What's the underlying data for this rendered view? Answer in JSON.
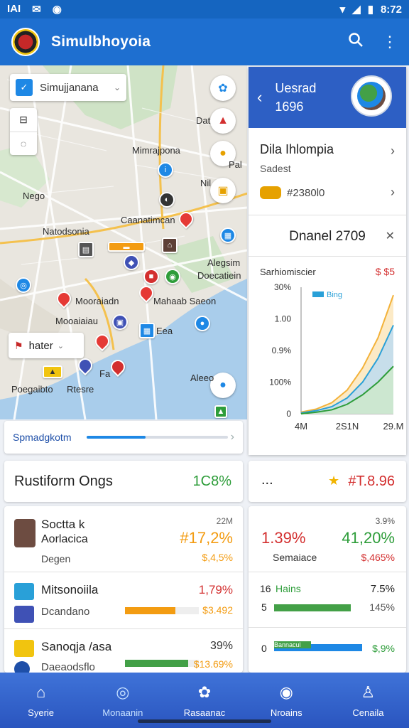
{
  "status": {
    "time": "8:72",
    "left_icons": [
      "IAI",
      "✉",
      "◉"
    ]
  },
  "app": {
    "title": "Simulbhoyoia"
  },
  "map": {
    "search": {
      "value": "Simujjanana"
    },
    "filter": {
      "value": "hater"
    },
    "labels": [
      "Mimrajpona",
      "Dat",
      "Pal",
      "Nil",
      "Nego",
      "Caanatimcan",
      "Natodsonia",
      "Alegsim",
      "Doecatiein",
      "Mooraiadn",
      "Mahaab Saeon",
      "Mooaiaiau",
      "Eea",
      "hater",
      "Fa",
      "Poegaibto",
      "Rtesre",
      "Aleeo",
      "Alegsim"
    ]
  },
  "panel": {
    "header": {
      "title_line1": "Uesrad",
      "title_line2": "1696"
    },
    "row1": {
      "title": "Dila Ihlompia",
      "sub": "Sadest"
    },
    "row2": {
      "value": "#2380l0"
    },
    "row3": {
      "title": "Dnanel 2709"
    },
    "chart": {
      "title": "Sarhiomiscier",
      "value": "$ $5"
    }
  },
  "chart_data": {
    "type": "area",
    "title": "Sarhiomiscier",
    "legend": [
      "Bing"
    ],
    "x": [
      "4M",
      "2S1N",
      "29.M"
    ],
    "y_ticks": [
      "0",
      "100%",
      "0.9%",
      "1.00",
      "30%"
    ],
    "series": [
      {
        "name": "Bing",
        "values": [
          2,
          6,
          14,
          30,
          58,
          96,
          150
        ]
      },
      {
        "values": [
          1,
          4,
          9,
          20,
          40,
          70,
          112
        ]
      },
      {
        "values": [
          0,
          2,
          5,
          12,
          24,
          40,
          60
        ]
      }
    ]
  },
  "progress": {
    "label": "Spmadgkotm",
    "fraction": 0.42
  },
  "summary": {
    "left_title": "Rustiform Ongs",
    "left_value": "1C8%",
    "right_dots": "...",
    "right_value": "#T.8.96"
  },
  "stats": {
    "item1": {
      "name": "Soctta k",
      "name2": "Aorlacica",
      "sub": "Degen",
      "top": "22M",
      "value": "#17,2%",
      "sub_value": "$,4,5%"
    },
    "item2": {
      "name": "Mitsonoiila",
      "sub": "Dcandano",
      "value": "1,79%",
      "sub_value": "$3.492",
      "bar_fraction": 0.68
    },
    "item3": {
      "name": "Sanoqja /asa",
      "sub": "Daeaodsflo",
      "value": "39%",
      "sub_value": "$13.69%",
      "bar_fraction": 0.86
    },
    "right1": {
      "top": "3.9%",
      "left_value": "1.39%",
      "right_value": "41,20%",
      "left_sub": "Semaiace",
      "right_sub": "$,465%"
    },
    "right2": {
      "num": "16",
      "label": "Hains",
      "value": "7.5%",
      "num2": "5",
      "value2": "145%"
    },
    "right3": {
      "num": "0",
      "label": "Bannacul",
      "value": "$,9%"
    }
  },
  "nav": [
    {
      "label": "Syerie",
      "icon": "home-icon"
    },
    {
      "label": "Monaanin",
      "icon": "circle-icon"
    },
    {
      "label": "Rasaanac",
      "icon": "flower-icon"
    },
    {
      "label": "Nroains",
      "icon": "gauge-icon"
    },
    {
      "label": "Cenaila",
      "icon": "person-icon"
    }
  ]
}
